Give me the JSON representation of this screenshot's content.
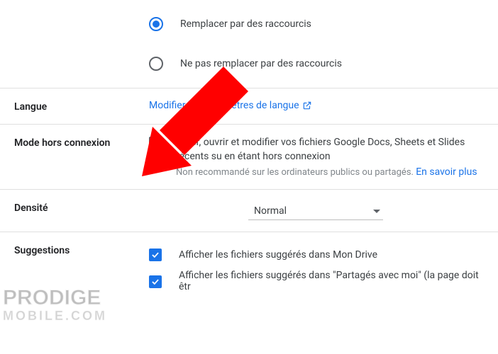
{
  "radios": {
    "replace": "Remplacer par des raccourcis",
    "dont_replace": "Ne pas remplacer par des raccourcis"
  },
  "language": {
    "label": "Langue",
    "link": "Modifier les paramètres de langue"
  },
  "offline": {
    "label": "Mode hors connexion",
    "text": "Créer, ouvrir et modifier vos fichiers Google Docs, Sheets et Slides récents su en étant hors connexion",
    "sub_prefix": "Non recommandé sur les ordinateurs publics ou partagés. ",
    "sub_link": "En savoir plus"
  },
  "density": {
    "label": "Densité",
    "value": "Normal"
  },
  "suggestions": {
    "label": "Suggestions",
    "opt1": "Afficher les fichiers suggérés dans Mon Drive",
    "opt2": "Afficher les fichiers suggérés dans \"Partagés avec moi\" (la page doit êtr"
  },
  "watermark": {
    "line1": "PRODIGE",
    "line2": "MOBILE.COM"
  }
}
